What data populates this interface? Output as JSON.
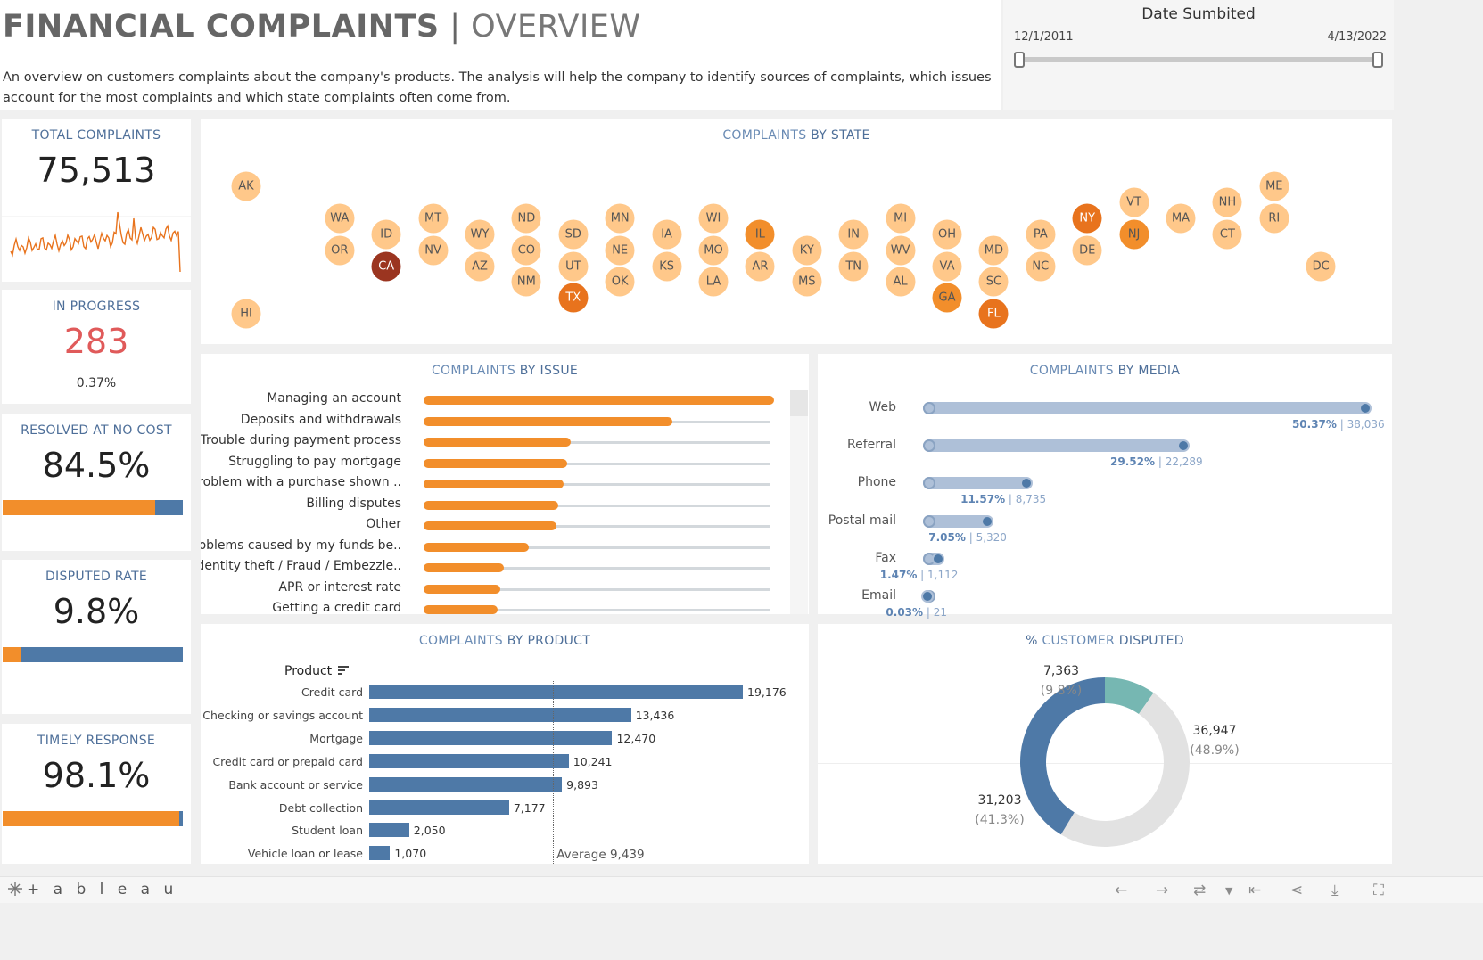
{
  "header": {
    "title_bold": "FINANCIAL COMPLAINTS",
    "title_sep": " | ",
    "title_light": "OVERVIEW",
    "description": "An overview on customers complaints about the company's products. The analysis will help the company to identify sources of complaints, which issues account for the most complaints and which state complaints often come from."
  },
  "date_filter": {
    "label": "Date Sumbited",
    "start": "12/1/2011",
    "end": "4/13/2022"
  },
  "kpis": {
    "total": {
      "label": "TOTAL COMPLAINTS",
      "value": "75,513"
    },
    "in_progress": {
      "label": "IN PROGRESS",
      "value": "283",
      "sub": "0.37%"
    },
    "resolved": {
      "label": "RESOLVED AT NO COST",
      "value": "84.5%",
      "fill": 0.845
    },
    "disputed": {
      "label": "DISPUTED RATE",
      "value": "9.8%",
      "fill": 0.098
    },
    "timely": {
      "label": "TIMELY RESPONSE",
      "value": "98.1%",
      "fill": 0.981
    }
  },
  "state_panel": {
    "title_light": "COMPLAINTS",
    "title_bold": " BY STATE",
    "states": [
      {
        "code": "AK",
        "col": 0,
        "row": 0,
        "level": 1
      },
      {
        "code": "HI",
        "col": 0,
        "row": 8,
        "level": 1
      },
      {
        "code": "WA",
        "col": 2,
        "row": 2,
        "level": 1
      },
      {
        "code": "OR",
        "col": 2,
        "row": 4,
        "level": 1
      },
      {
        "code": "ID",
        "col": 3,
        "row": 3,
        "level": 1
      },
      {
        "code": "CA",
        "col": 3,
        "row": 5,
        "level": 4
      },
      {
        "code": "MT",
        "col": 4,
        "row": 2,
        "level": 1
      },
      {
        "code": "NV",
        "col": 4,
        "row": 4,
        "level": 1
      },
      {
        "code": "WY",
        "col": 5,
        "row": 3,
        "level": 1
      },
      {
        "code": "AZ",
        "col": 5,
        "row": 5,
        "level": 1
      },
      {
        "code": "ND",
        "col": 6,
        "row": 2,
        "level": 1
      },
      {
        "code": "CO",
        "col": 6,
        "row": 4,
        "level": 1
      },
      {
        "code": "NM",
        "col": 6,
        "row": 6,
        "level": 1
      },
      {
        "code": "SD",
        "col": 7,
        "row": 3,
        "level": 1
      },
      {
        "code": "UT",
        "col": 7,
        "row": 5,
        "level": 1
      },
      {
        "code": "TX",
        "col": 7,
        "row": 7,
        "level": 3
      },
      {
        "code": "MN",
        "col": 8,
        "row": 2,
        "level": 1
      },
      {
        "code": "NE",
        "col": 8,
        "row": 4,
        "level": 1
      },
      {
        "code": "OK",
        "col": 8,
        "row": 6,
        "level": 1
      },
      {
        "code": "IA",
        "col": 9,
        "row": 3,
        "level": 1
      },
      {
        "code": "KS",
        "col": 9,
        "row": 5,
        "level": 1
      },
      {
        "code": "WI",
        "col": 10,
        "row": 2,
        "level": 1
      },
      {
        "code": "MO",
        "col": 10,
        "row": 4,
        "level": 1
      },
      {
        "code": "LA",
        "col": 10,
        "row": 6,
        "level": 1
      },
      {
        "code": "IL",
        "col": 11,
        "row": 3,
        "level": 2
      },
      {
        "code": "AR",
        "col": 11,
        "row": 5,
        "level": 1
      },
      {
        "code": "KY",
        "col": 12,
        "row": 4,
        "level": 1
      },
      {
        "code": "MS",
        "col": 12,
        "row": 6,
        "level": 1
      },
      {
        "code": "IN",
        "col": 13,
        "row": 3,
        "level": 1
      },
      {
        "code": "TN",
        "col": 13,
        "row": 5,
        "level": 1
      },
      {
        "code": "MI",
        "col": 14,
        "row": 2,
        "level": 1
      },
      {
        "code": "WV",
        "col": 14,
        "row": 4,
        "level": 1
      },
      {
        "code": "AL",
        "col": 14,
        "row": 6,
        "level": 1
      },
      {
        "code": "OH",
        "col": 15,
        "row": 3,
        "level": 1
      },
      {
        "code": "VA",
        "col": 15,
        "row": 5,
        "level": 1
      },
      {
        "code": "GA",
        "col": 15,
        "row": 7,
        "level": 2
      },
      {
        "code": "MD",
        "col": 16,
        "row": 4,
        "level": 1
      },
      {
        "code": "SC",
        "col": 16,
        "row": 6,
        "level": 1
      },
      {
        "code": "FL",
        "col": 16,
        "row": 8,
        "level": 3
      },
      {
        "code": "PA",
        "col": 17,
        "row": 3,
        "level": 1
      },
      {
        "code": "NC",
        "col": 17,
        "row": 5,
        "level": 1
      },
      {
        "code": "NY",
        "col": 18,
        "row": 2,
        "level": 3
      },
      {
        "code": "DE",
        "col": 18,
        "row": 4,
        "level": 1
      },
      {
        "code": "VT",
        "col": 19,
        "row": 1,
        "level": 1
      },
      {
        "code": "NJ",
        "col": 19,
        "row": 3,
        "level": 2
      },
      {
        "code": "MA",
        "col": 20,
        "row": 2,
        "level": 1
      },
      {
        "code": "NH",
        "col": 21,
        "row": 1,
        "level": 1
      },
      {
        "code": "CT",
        "col": 21,
        "row": 3,
        "level": 1
      },
      {
        "code": "ME",
        "col": 22,
        "row": 0,
        "level": 1
      },
      {
        "code": "RI",
        "col": 22,
        "row": 2,
        "level": 1
      },
      {
        "code": "DC",
        "col": 23,
        "row": 5,
        "level": 1
      }
    ]
  },
  "issue_panel": {
    "title_light": "COMPLAINTS",
    "title_bold": " BY ISSUE",
    "issues": [
      {
        "label": "Managing an account",
        "value": 1.0
      },
      {
        "label": "Deposits and withdrawals",
        "value": 0.71
      },
      {
        "label": "Trouble during payment process",
        "value": 0.42
      },
      {
        "label": "Struggling to pay mortgage",
        "value": 0.41
      },
      {
        "label": "Problem with a purchase shown ..",
        "value": 0.4
      },
      {
        "label": "Billing disputes",
        "value": 0.385
      },
      {
        "label": "Other",
        "value": 0.38
      },
      {
        "label": "Problems caused by my funds be..",
        "value": 0.3
      },
      {
        "label": "Identity theft / Fraud / Embezzle..",
        "value": 0.23
      },
      {
        "label": "APR or interest rate",
        "value": 0.22
      },
      {
        "label": "Getting a credit card",
        "value": 0.21
      }
    ]
  },
  "media_panel": {
    "title_light": "COMPLAINTS",
    "title_bold": " BY MEDIA",
    "channels": [
      {
        "label": "Web",
        "pct": "50.37%",
        "count": "38,036",
        "fraction": 0.5037
      },
      {
        "label": "Referral",
        "pct": "29.52%",
        "count": "22,289",
        "fraction": 0.2952
      },
      {
        "label": "Phone",
        "pct": "11.57%",
        "count": "8,735",
        "fraction": 0.1157
      },
      {
        "label": "Postal mail",
        "pct": "7.05%",
        "count": "5,320",
        "fraction": 0.0705
      },
      {
        "label": "Fax",
        "pct": "1.47%",
        "count": "1,112",
        "fraction": 0.0147
      },
      {
        "label": "Email",
        "pct": "0.03%",
        "count": "21",
        "fraction": 0.0003
      }
    ]
  },
  "chart_data": [
    {
      "type": "bar",
      "title": "COMPLAINTS BY PRODUCT",
      "header": "Product",
      "categories": [
        "Credit card",
        "Checking or savings account",
        "Mortgage",
        "Credit card or prepaid card",
        "Bank account or service",
        "Debt collection",
        "Student loan",
        "Vehicle loan or lease"
      ],
      "values": [
        19176,
        13436,
        12470,
        10241,
        9893,
        7177,
        2050,
        1070
      ],
      "labels": [
        "19,176",
        "13,436",
        "12,470",
        "10,241",
        "9,893",
        "7,177",
        "2,050",
        "1,070"
      ],
      "average": 9439,
      "average_label": "Average 9,439"
    },
    {
      "type": "pie",
      "title": "% CUSTOMER DISPUTED",
      "slices": [
        {
          "value": 7363,
          "label": "7,363",
          "pct": "(9.8%)",
          "color": "#76b7b2"
        },
        {
          "value": 36947,
          "label": "36,947",
          "pct": "(48.9%)",
          "color": "#e2e2e2"
        },
        {
          "value": 31203,
          "label": "31,203",
          "pct": "(41.3%)",
          "color": "#4e79a7"
        }
      ]
    }
  ],
  "product_panel": {
    "title_light": "COMPLAINTS",
    "title_bold": " BY PRODUCT"
  },
  "disputed_panel": {
    "title_pct": "%",
    "title_light": " CUSTOMER",
    "title_bold": " DISPUTED"
  },
  "footer": {
    "logo": "+ a b l e a u"
  },
  "colors": {
    "accent_orange": "#f28e2b",
    "accent_blue": "#4e79a7",
    "title_blue": "#4e6f99",
    "in_progress_red": "#e05a5a"
  }
}
